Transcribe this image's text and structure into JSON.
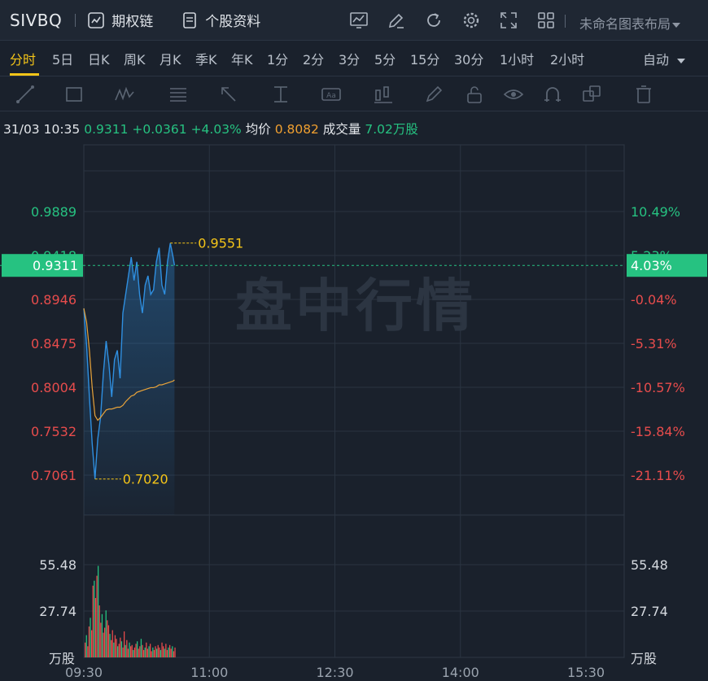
{
  "header": {
    "symbol": "SIVBQ",
    "options_chain": "期权链",
    "stock_profile": "个股资料",
    "layout_name": "未命名图表布局",
    "icons": [
      "chart-type-icon",
      "draw-pen-icon",
      "refresh-icon",
      "settings-gear-icon",
      "fullscreen-icon",
      "grid-layout-icon"
    ]
  },
  "tabs": [
    "分时",
    "5日",
    "日K",
    "周K",
    "月K",
    "季K",
    "年K",
    "1分",
    "2分",
    "3分",
    "5分",
    "15分",
    "30分",
    "1小时",
    "2小时"
  ],
  "active_tab": "分时",
  "auto_label": "自动",
  "info": {
    "datetime": "31/03 10:35",
    "price": "0.9311",
    "change": "+0.0361",
    "change_pct": "+4.03%",
    "avg_label": "均价",
    "avg_value": "0.8082",
    "volume_label": "成交量",
    "volume_value": "7.02万股"
  },
  "watermark": "盘中行情",
  "colors": {
    "up": "#26c281",
    "down": "#e74c4c",
    "price_line": "#2f8fe0",
    "avg_line": "#e8a33a",
    "label_yellow": "#f5c518",
    "background": "#1a212c"
  },
  "chart_data": {
    "type": "line",
    "title": "",
    "x_ticks": [
      "09:30",
      "11:00",
      "12:30",
      "14:00",
      "15:30"
    ],
    "prev_close": 0.895,
    "y_left_ticks": [
      "0.9889",
      "0.9418",
      "0.8946",
      "0.8475",
      "0.8004",
      "0.7532",
      "0.7061"
    ],
    "y_right_ticks": [
      "10.49%",
      "5.23%",
      "-0.04%",
      "-5.31%",
      "-10.57%",
      "-15.84%",
      "-21.11%"
    ],
    "current_price_label": "0.9311",
    "current_pct_label": "4.03%",
    "high_label": "0.9551",
    "low_label": "0.7020",
    "volume_ticks": [
      "55.48",
      "27.74"
    ],
    "volume_unit": "万股",
    "series": [
      {
        "x": [
          "09:30",
          "09:32",
          "09:34",
          "09:36",
          "09:38",
          "09:40",
          "09:42",
          "09:44",
          "09:46",
          "09:48",
          "09:50",
          "09:52",
          "09:54",
          "09:56",
          "09:58",
          "10:00",
          "10:02",
          "10:04",
          "10:06",
          "10:08",
          "10:10",
          "10:12",
          "10:14",
          "10:16",
          "10:18",
          "10:20",
          "10:22",
          "10:24",
          "10:26",
          "10:28",
          "10:30",
          "10:32",
          "10:34",
          "10:35"
        ],
        "values": [
          0.885,
          0.845,
          0.79,
          0.74,
          0.702,
          0.745,
          0.768,
          0.815,
          0.85,
          0.825,
          0.79,
          0.83,
          0.84,
          0.81,
          0.88,
          0.9,
          0.92,
          0.94,
          0.915,
          0.935,
          0.9,
          0.88,
          0.91,
          0.92,
          0.9,
          0.905,
          0.935,
          0.95,
          0.91,
          0.9,
          0.935,
          0.9551,
          0.94,
          0.9311
        ]
      },
      {
        "x": [
          "09:30",
          "09:32",
          "09:34",
          "09:36",
          "09:38",
          "09:40",
          "09:42",
          "09:44",
          "09:46",
          "09:48",
          "09:50",
          "09:52",
          "09:54",
          "09:56",
          "09:58",
          "10:00",
          "10:02",
          "10:04",
          "10:06",
          "10:08",
          "10:10",
          "10:12",
          "10:14",
          "10:16",
          "10:18",
          "10:20",
          "10:22",
          "10:24",
          "10:26",
          "10:28",
          "10:30",
          "10:32",
          "10:34",
          "10:35"
        ],
        "values": [
          0.885,
          0.87,
          0.84,
          0.8,
          0.77,
          0.765,
          0.768,
          0.772,
          0.776,
          0.777,
          0.777,
          0.778,
          0.779,
          0.779,
          0.781,
          0.785,
          0.788,
          0.791,
          0.792,
          0.795,
          0.796,
          0.797,
          0.798,
          0.799,
          0.8,
          0.8,
          0.801,
          0.803,
          0.803,
          0.804,
          0.805,
          0.806,
          0.807,
          0.8082
        ]
      }
    ],
    "volume": [
      12,
      18,
      9,
      25,
      32,
      22,
      58,
      62,
      48,
      66,
      74,
      42,
      28,
      35,
      20,
      24,
      38,
      30,
      26,
      19,
      14,
      22,
      12,
      18,
      15,
      9,
      11,
      16,
      13,
      8,
      21,
      10,
      14,
      7,
      12,
      9,
      10,
      6,
      8,
      11,
      13,
      7,
      9,
      15,
      10,
      6,
      8,
      12,
      7,
      9,
      11,
      5,
      8,
      6,
      9,
      7,
      10,
      8,
      6,
      12,
      9,
      7,
      11,
      6,
      8,
      10,
      7,
      9,
      5,
      8
    ]
  }
}
